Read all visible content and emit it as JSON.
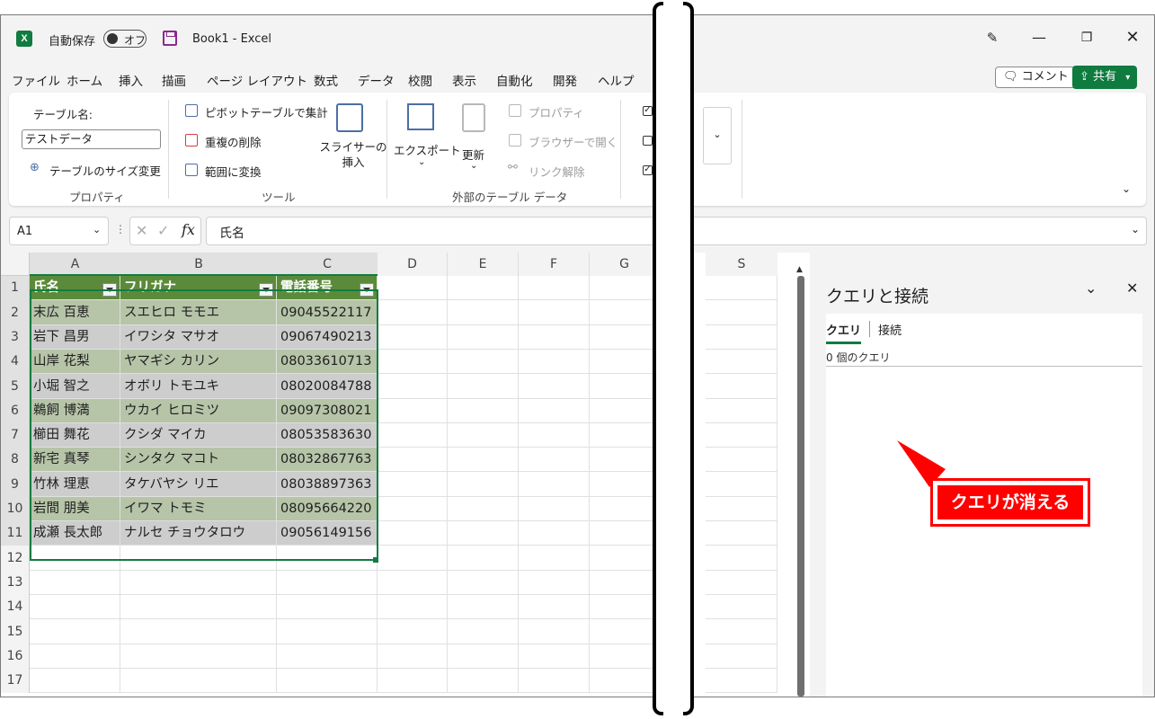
{
  "titlebar": {
    "autosave_label": "自動保存",
    "autosave_state": "オフ",
    "doc_title": "Book1 - Excel",
    "logo_letter": "X"
  },
  "menu": {
    "items": [
      "ファイル",
      "ホーム",
      "挿入",
      "描画",
      "ページ レイアウト",
      "数式",
      "データ",
      "校閲",
      "表示",
      "自動化",
      "開発",
      "ヘルプ"
    ],
    "comment_label": "コメント",
    "share_label": "共有"
  },
  "ribbon": {
    "properties": {
      "table_name_label": "テーブル名:",
      "table_name_value": "テストデータ",
      "resize_label": "テーブルのサイズ変更",
      "group_label": "プロパティ"
    },
    "tools": {
      "pivot_label": "ピボットテーブルで集計",
      "remove_dup_label": "重複の削除",
      "convert_label": "範囲に変換",
      "slicer_label": "スライサーの挿入",
      "group_label": "ツール"
    },
    "external": {
      "export_label": "エクスポート",
      "refresh_label": "更新",
      "properties_label": "プロパティ",
      "open_browser_label": "ブラウザーで開く",
      "unlink_label": "リンク解除",
      "group_label": "外部のテーブル データ"
    }
  },
  "formula_bar": {
    "name_box": "A1",
    "fx": "fx",
    "formula": "氏名"
  },
  "sheet": {
    "columns": [
      "A",
      "B",
      "C",
      "D",
      "E",
      "F",
      "G",
      "S"
    ],
    "row_numbers": [
      "1",
      "2",
      "3",
      "4",
      "5",
      "6",
      "7",
      "8",
      "9",
      "10",
      "11",
      "12",
      "13",
      "14",
      "15",
      "16",
      "17"
    ],
    "headers": [
      "氏名",
      "フリガナ",
      "電話番号"
    ],
    "rows": [
      [
        "末広 百恵",
        "スエヒロ モモエ",
        "09045522117"
      ],
      [
        "岩下 昌男",
        "イワシタ マサオ",
        "09067490213"
      ],
      [
        "山岸 花梨",
        "ヤマギシ カリン",
        "08033610713"
      ],
      [
        "小堀 智之",
        "オボリ トモユキ",
        "08020084788"
      ],
      [
        "鵜飼 博満",
        "ウカイ ヒロミツ",
        "09097308021"
      ],
      [
        "櫛田 舞花",
        "クシダ マイカ",
        "08053583630"
      ],
      [
        "新宅 真琴",
        "シンタク マコト",
        "08032867763"
      ],
      [
        "竹林 理恵",
        "タケバヤシ リエ",
        "08038897363"
      ],
      [
        "岩間 朋美",
        "イワマ トモミ",
        "08095664220"
      ],
      [
        "成瀬 長太郎",
        "ナルセ チョウタロウ",
        "09056149156"
      ]
    ]
  },
  "pane": {
    "title": "クエリと接続",
    "tab_queries": "クエリ",
    "tab_connections": "接続",
    "count_text": "0 個のクエリ"
  },
  "annotation": {
    "callout_text": "クエリが消える",
    "color": "#ff0000"
  },
  "colors": {
    "excel_green": "#107c41",
    "table_header": "#5b8b3a",
    "band_green": "#b6c4a8",
    "band_gray": "#cdcdcd"
  }
}
